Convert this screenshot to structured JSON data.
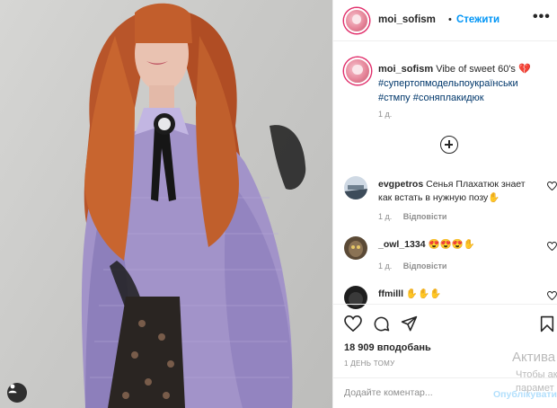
{
  "post": {
    "username": "moi_sofism",
    "separator": "•",
    "follow_label": "Стежити",
    "more_label": "•••"
  },
  "caption": {
    "username": "moi_sofism",
    "text": "Vibe of sweet 60's 💔",
    "hashtags": [
      "#супертопмодельпоукраїнськи",
      "#стмпу",
      "#соняплакидюк"
    ],
    "time": "1 д."
  },
  "comments": [
    {
      "username": "evgpetros",
      "text": "Сенья Плахатюк знает как встать в нужную позу✋",
      "time": "1 д.",
      "reply_label": "Відповісти"
    },
    {
      "username": "_owl_1334",
      "text": "😍😍😍✋",
      "time": "1 д.",
      "reply_label": "Відповісти"
    },
    {
      "username": "ffmilll",
      "text": "✋✋✋",
      "time": "",
      "reply_label": ""
    }
  ],
  "likes": {
    "count": "18 909",
    "label": "вподобань"
  },
  "posted_ago": "1 ДЕНЬ ТОМУ",
  "comment_box": {
    "placeholder": "Додайте коментар...",
    "post_label": "Опублікувати"
  },
  "watermark": {
    "line1": "Актива",
    "line2": "Чтобы ак",
    "line3": "парамет"
  },
  "icons": [
    "more-options-icon",
    "heart-icon",
    "load-more-icon",
    "comment-icon",
    "share-icon",
    "save-icon",
    "user-tag-icon"
  ],
  "colors": {
    "link": "#0095f6",
    "hashtag": "#00376b",
    "muted": "#8e8e8e",
    "border": "#efefef"
  }
}
